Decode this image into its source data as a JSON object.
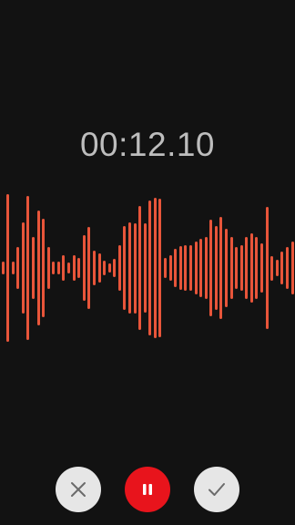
{
  "recorder": {
    "elapsed_time": "00:12.10"
  },
  "waveform": {
    "color": "#e8553a",
    "levels": [
      0.08,
      0.9,
      0.08,
      0.26,
      0.56,
      0.88,
      0.38,
      0.7,
      0.6,
      0.26,
      0.08,
      0.08,
      0.16,
      0.07,
      0.16,
      0.12,
      0.4,
      0.5,
      0.21,
      0.18,
      0.09,
      0.06,
      0.11,
      0.28,
      0.51,
      0.56,
      0.55,
      0.76,
      0.54,
      0.82,
      0.86,
      0.84,
      0.12,
      0.16,
      0.23,
      0.27,
      0.28,
      0.28,
      0.32,
      0.36,
      0.38,
      0.59,
      0.51,
      0.62,
      0.48,
      0.38,
      0.26,
      0.28,
      0.38,
      0.42,
      0.38,
      0.3,
      0.74,
      0.15,
      0.1,
      0.2,
      0.26,
      0.32
    ]
  },
  "controls": {
    "discard": {
      "icon": "close-icon",
      "background": "#e6e6e6",
      "icon_color": "#6b6b6b"
    },
    "pause": {
      "icon": "pause-icon",
      "background": "#e8141c",
      "icon_color": "#ffffff"
    },
    "save": {
      "icon": "checkmark-icon",
      "background": "#e6e6e6",
      "icon_color": "#6b6b6b"
    }
  }
}
